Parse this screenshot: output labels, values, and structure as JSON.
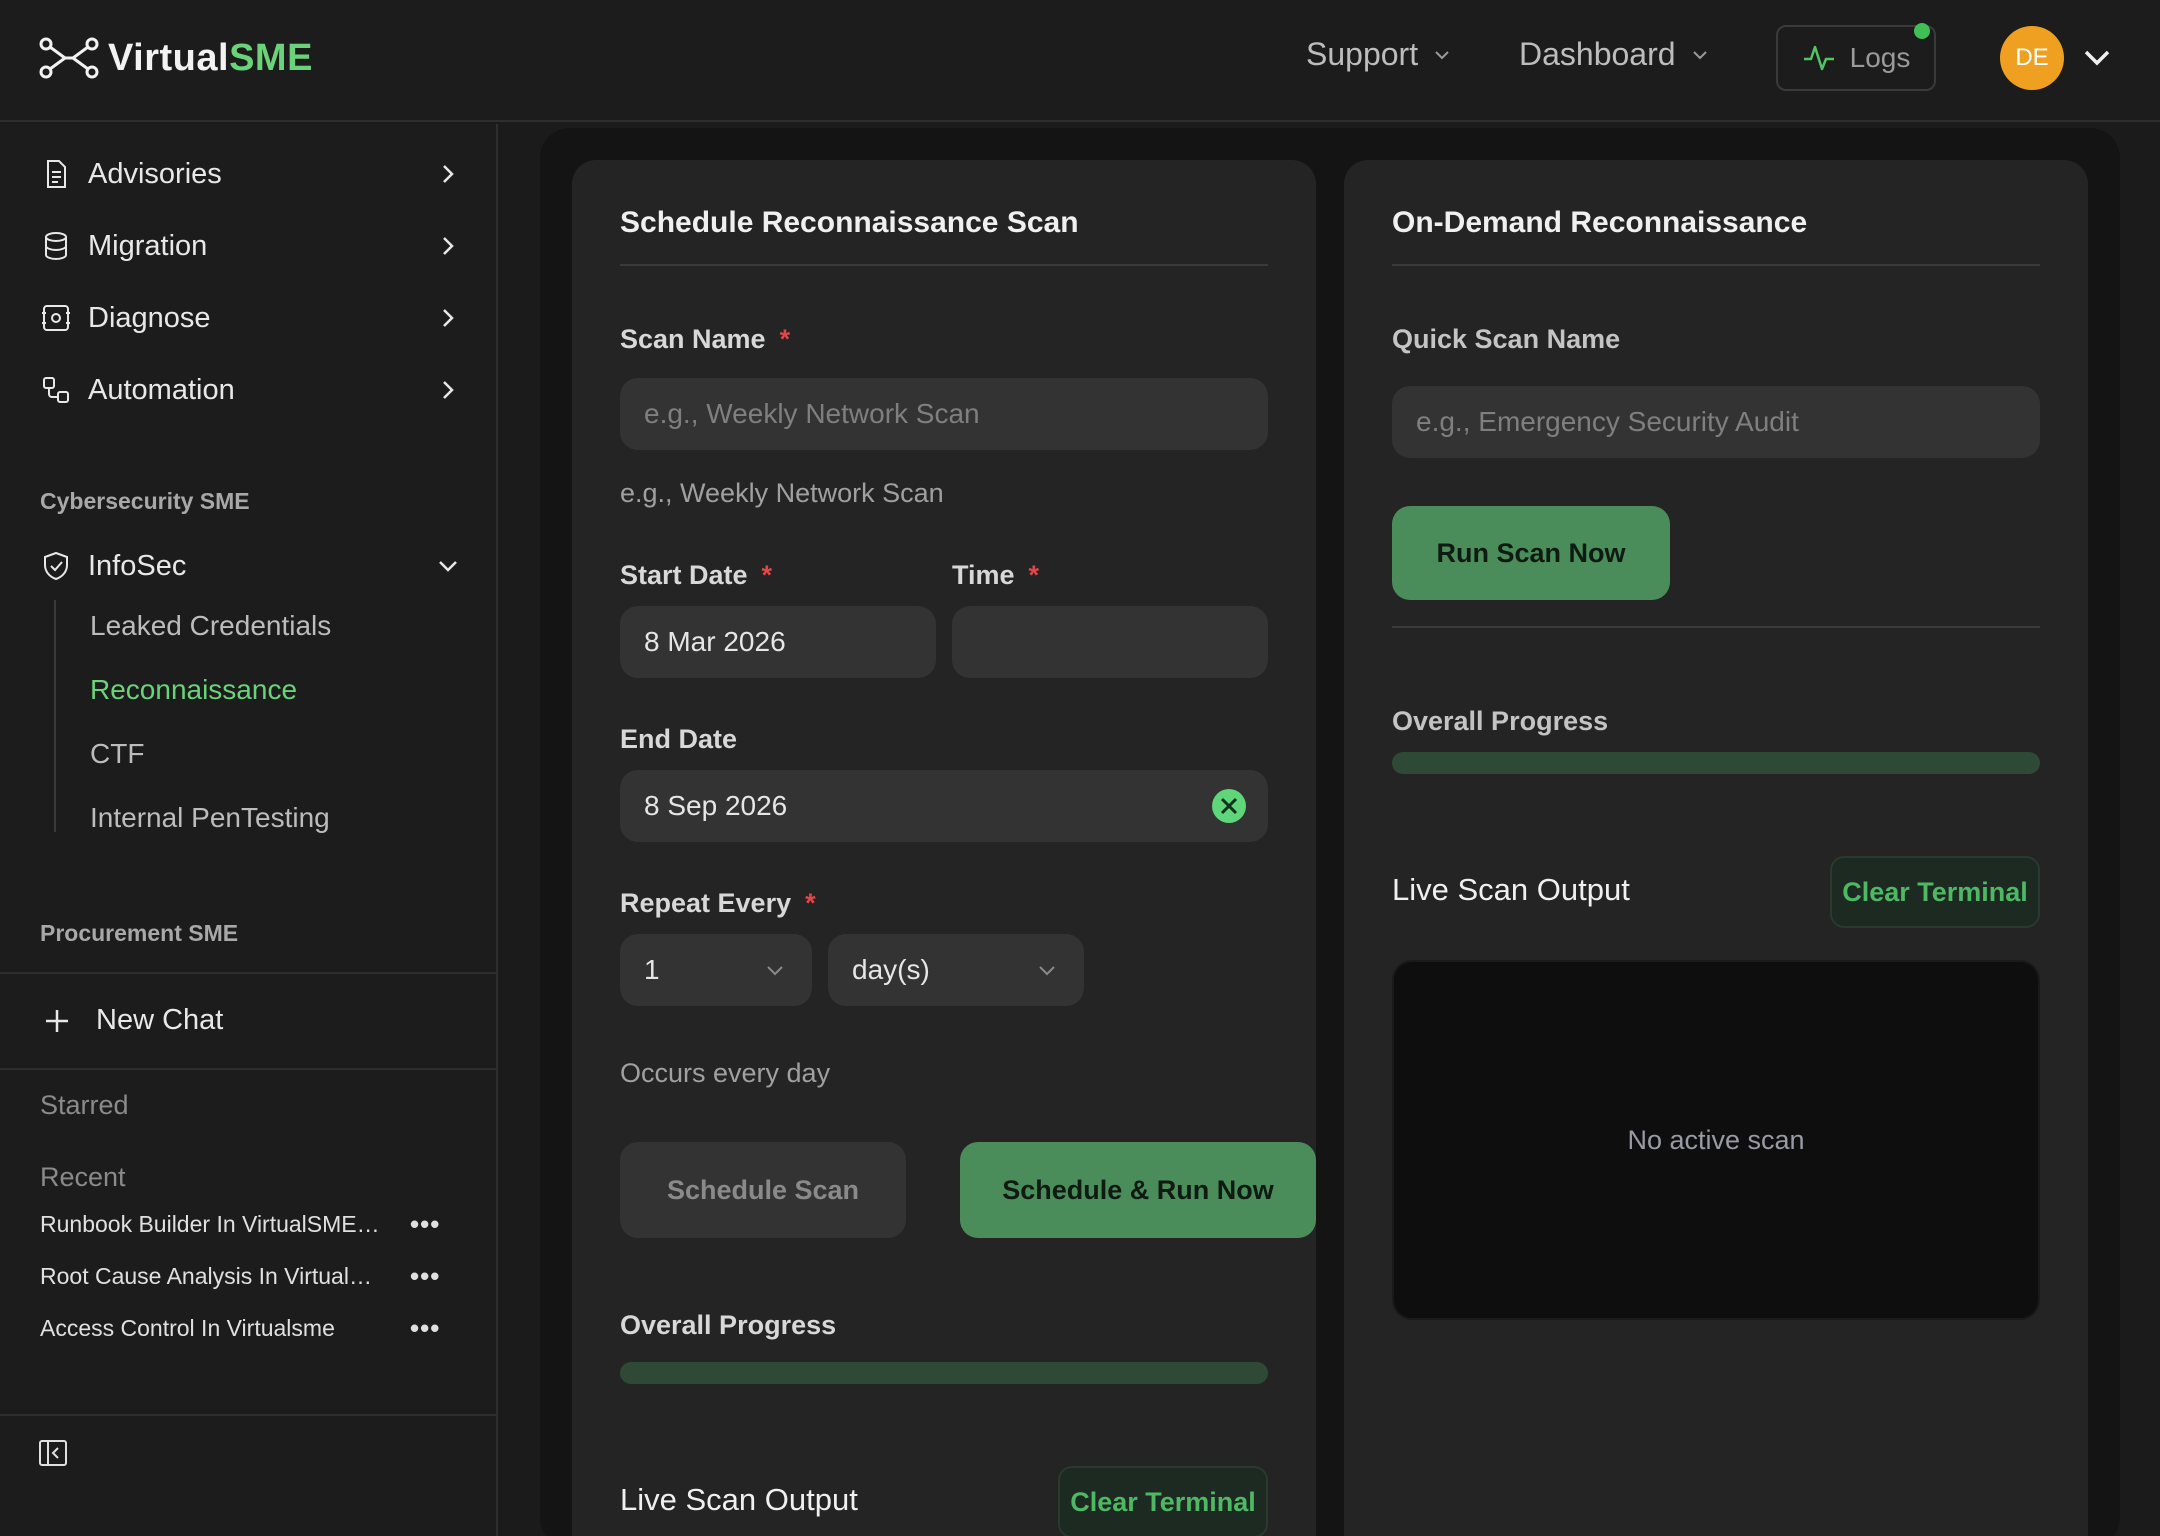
{
  "header": {
    "logo_prefix": "Virtual",
    "logo_accent": "SME",
    "nav": [
      {
        "label": "Support"
      },
      {
        "label": "Dashboard"
      }
    ],
    "logs_label": "Logs",
    "avatar_initials": "DE"
  },
  "sidebar": {
    "items": [
      {
        "label": "Advisories",
        "icon": "document-icon"
      },
      {
        "label": "Migration",
        "icon": "database-icon"
      },
      {
        "label": "Diagnose",
        "icon": "diagnose-icon"
      },
      {
        "label": "Automation",
        "icon": "workflow-icon"
      }
    ],
    "section_cyber": "Cybersecurity SME",
    "infosec_label": "InfoSec",
    "infosec_sub": [
      {
        "label": "Leaked Credentials"
      },
      {
        "label": "Reconnaissance"
      },
      {
        "label": "CTF"
      },
      {
        "label": "Internal PenTesting"
      }
    ],
    "section_procurement": "Procurement SME",
    "new_chat": "New Chat",
    "starred": "Starred",
    "recent": "Recent",
    "recent_items": [
      {
        "label": "Runbook Builder In VirtualSME Platform"
      },
      {
        "label": "Root Cause Analysis In VirtualSME"
      },
      {
        "label": "Access Control In Virtualsme"
      }
    ],
    "more_label": "•••"
  },
  "schedule": {
    "title": "Schedule Reconnaissance Scan",
    "scan_name_label": "Scan Name",
    "required_mark": "*",
    "scan_name_placeholder": "e.g., Weekly Network Scan",
    "scan_name_hint": "e.g., Weekly Network Scan",
    "start_date_label": "Start Date",
    "start_date_value": "8 Mar 2026",
    "time_label": "Time",
    "time_value": "",
    "end_date_label": "End Date",
    "end_date_value": "8 Sep 2026",
    "repeat_label": "Repeat Every",
    "repeat_count": "1",
    "repeat_unit": "day(s)",
    "occurs_text": "Occurs every day",
    "schedule_btn": "Schedule Scan",
    "schedule_run_btn": "Schedule & Run Now",
    "progress_label": "Overall Progress",
    "progress_value": 0,
    "live_output_label": "Live Scan Output",
    "clear_terminal": "Clear Terminal"
  },
  "ondemand": {
    "title": "On-Demand Reconnaissance",
    "quick_name_label": "Quick Scan Name",
    "quick_name_placeholder": "e.g., Emergency Security Audit",
    "run_btn": "Run Scan Now",
    "progress_label": "Overall Progress",
    "progress_value": 0,
    "live_output_label": "Live Scan Output",
    "clear_terminal": "Clear Terminal",
    "terminal_empty": "No active scan"
  },
  "colors": {
    "accent": "#6ad37a",
    "button_green": "#4b8d5a",
    "avatar": "#f0a020",
    "required": "#e04848"
  }
}
